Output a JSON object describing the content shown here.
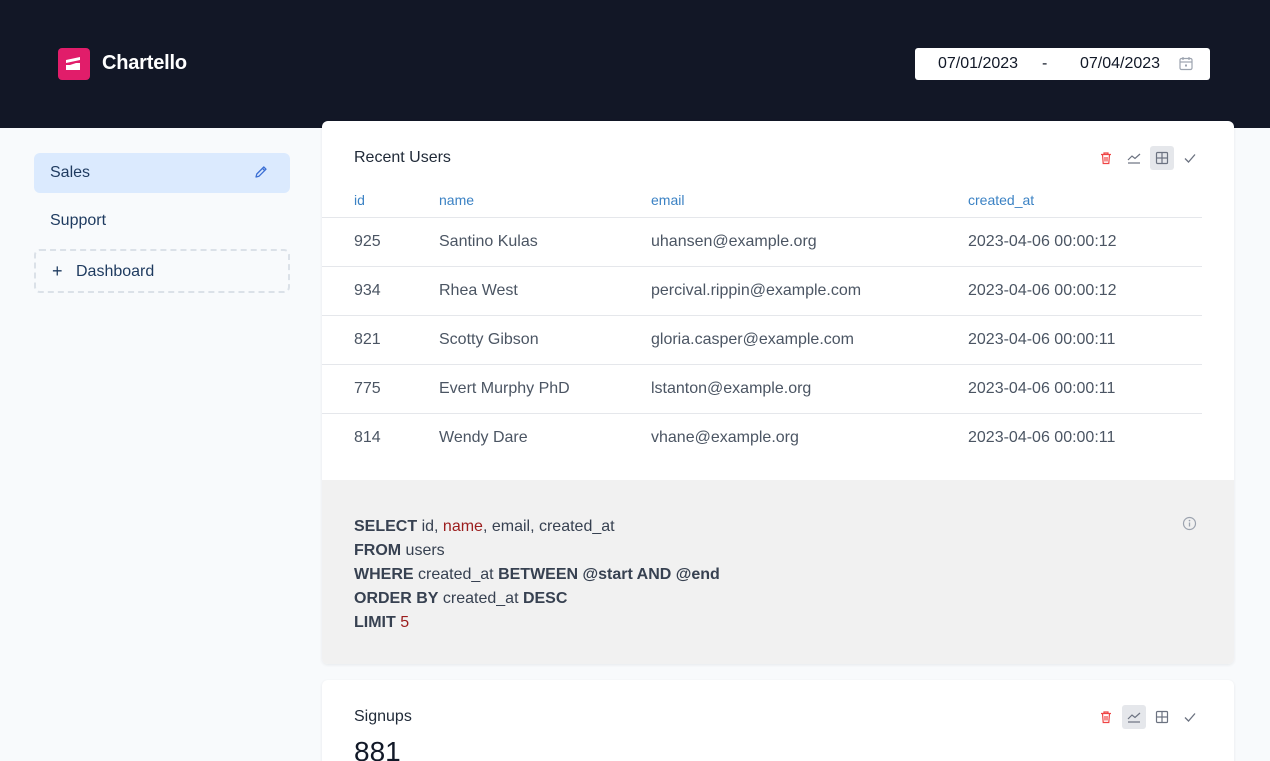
{
  "app": {
    "name": "Chartello"
  },
  "daterange": {
    "start": "07/01/2023",
    "separator": "-",
    "end": "07/04/2023"
  },
  "sidebar": {
    "items": [
      {
        "label": "Sales",
        "active": true
      },
      {
        "label": "Support",
        "active": false
      }
    ],
    "add_label": "Dashboard"
  },
  "panels": [
    {
      "title": "Recent Users",
      "columns": [
        "id",
        "name",
        "email",
        "created_at"
      ],
      "rows": [
        [
          "925",
          "Santino Kulas",
          "uhansen@example.org",
          "2023-04-06 00:00:12"
        ],
        [
          "934",
          "Rhea West",
          "percival.rippin@example.com",
          "2023-04-06 00:00:12"
        ],
        [
          "821",
          "Scotty Gibson",
          "gloria.casper@example.com",
          "2023-04-06 00:00:11"
        ],
        [
          "775",
          "Evert Murphy PhD",
          "lstanton@example.org",
          "2023-04-06 00:00:11"
        ],
        [
          "814",
          "Wendy Dare",
          "vhane@example.org",
          "2023-04-06 00:00:11"
        ]
      ],
      "sql": {
        "l1": {
          "kw": "SELECT",
          "a": " id, ",
          "b": "name",
          "c": ", email, created_at"
        },
        "l2": {
          "kw": "FROM",
          "a": " users"
        },
        "l3": {
          "kw": "WHERE",
          "a": " created_at ",
          "kw2": "BETWEEN @start AND @end"
        },
        "l4": {
          "kw": "ORDER BY",
          "a": " created_at ",
          "kw2": "DESC"
        },
        "l5": {
          "kw": "LIMIT",
          "a": " ",
          "b": "5"
        }
      }
    },
    {
      "title": "Signups",
      "value": "881"
    }
  ],
  "colors": {
    "header_bg": "#121726",
    "brand": "#e11d6a",
    "active_bg": "#dbeafe",
    "delete": "#ef4444"
  },
  "icons": [
    "logo-icon",
    "calendar-icon",
    "edit-icon",
    "plus-icon",
    "trash-icon",
    "line-chart-icon",
    "table-icon",
    "check-icon",
    "info-icon"
  ]
}
